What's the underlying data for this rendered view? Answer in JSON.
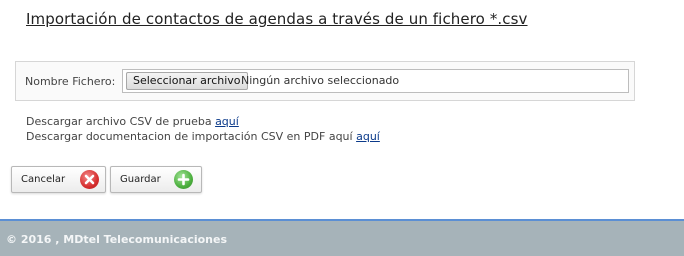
{
  "page": {
    "title": "Importación de contactos de agendas a través de un fichero *.csv"
  },
  "file_upload": {
    "label": "Nombre Fichero:",
    "button_label": "Seleccionar archivo",
    "status_text": "Ningún archivo seleccionado"
  },
  "downloads": {
    "csv_text": "Descargar archivo CSV de prueba",
    "csv_link": "aquí",
    "pdf_text": "Descargar documentacion de importación CSV en PDF aquí",
    "pdf_link": "aquí"
  },
  "actions": {
    "cancel_label": "Cancelar",
    "cancel_icon": "cancel-x-icon",
    "save_label": "Guardar",
    "save_icon": "add-plus-icon"
  },
  "footer": {
    "text": "© 2016 , MDtel Telecomunicaciones"
  },
  "colors": {
    "footer_bg": "#a6b3b9",
    "footer_border": "#5b8fd4",
    "link": "#0b3a8a",
    "cancel_icon": "#d62f2f",
    "save_icon": "#4caf3e"
  }
}
